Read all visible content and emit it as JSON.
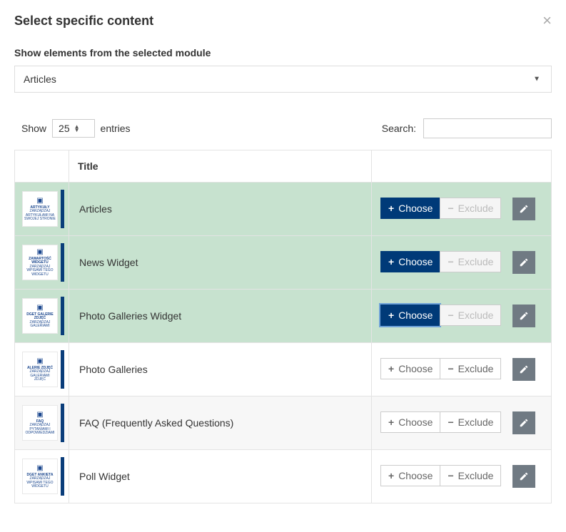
{
  "modal": {
    "title": "Select specific content",
    "close_label": "×"
  },
  "form": {
    "module_label": "Show elements from the selected module",
    "module_selected": "Articles"
  },
  "table": {
    "show_label": "Show",
    "entries_label": "entries",
    "entries_value": "25",
    "search_label": "Search:",
    "search_value": "",
    "columns": {
      "thumb": "",
      "title": "Title",
      "actions": ""
    },
    "choose_label": "Choose",
    "exclude_label": "Exclude",
    "rows": [
      {
        "thumb_title": "ARTYKUŁY",
        "thumb_sub": "ZARZĄDZAJ ARTYKUŁAMI NA SWOJEJ STRONIE",
        "title": "Articles",
        "chosen": true,
        "exclude_disabled": true,
        "row_state": "selected"
      },
      {
        "thumb_title": "ZAWARTOŚĆ WIDGETU",
        "thumb_sub": "ZARZĄDZAJ WPISAMI TEGO WIDGETU",
        "title": "News Widget",
        "chosen": true,
        "exclude_disabled": true,
        "row_state": "selected"
      },
      {
        "thumb_title": "DGET GALERIE ZDJĘĆ",
        "thumb_sub": "ZARZĄDZAJ GALERIAMI",
        "title": "Photo Galleries Widget",
        "chosen": true,
        "chosen_focus": true,
        "exclude_disabled": true,
        "row_state": "selected"
      },
      {
        "thumb_title": "ALERIE ZDJĘĆ",
        "thumb_sub": "ZARZĄDZAJ GALERIAMI ZDJĘĆ",
        "title": "Photo Galleries",
        "chosen": false,
        "exclude_disabled": false,
        "row_state": ""
      },
      {
        "thumb_title": "FAQ",
        "thumb_sub": "ZARZĄDZAJ PYTANIAMI I ODPOWIEDZIAMI",
        "title": "FAQ (Frequently Asked Questions)",
        "chosen": false,
        "exclude_disabled": false,
        "row_state": "alt"
      },
      {
        "thumb_title": "DGET ANKIETA",
        "thumb_sub": "ZARZĄDZAJ WPISAMI TEGO WIDGETU",
        "title": "Poll Widget",
        "chosen": false,
        "exclude_disabled": false,
        "row_state": ""
      }
    ]
  }
}
